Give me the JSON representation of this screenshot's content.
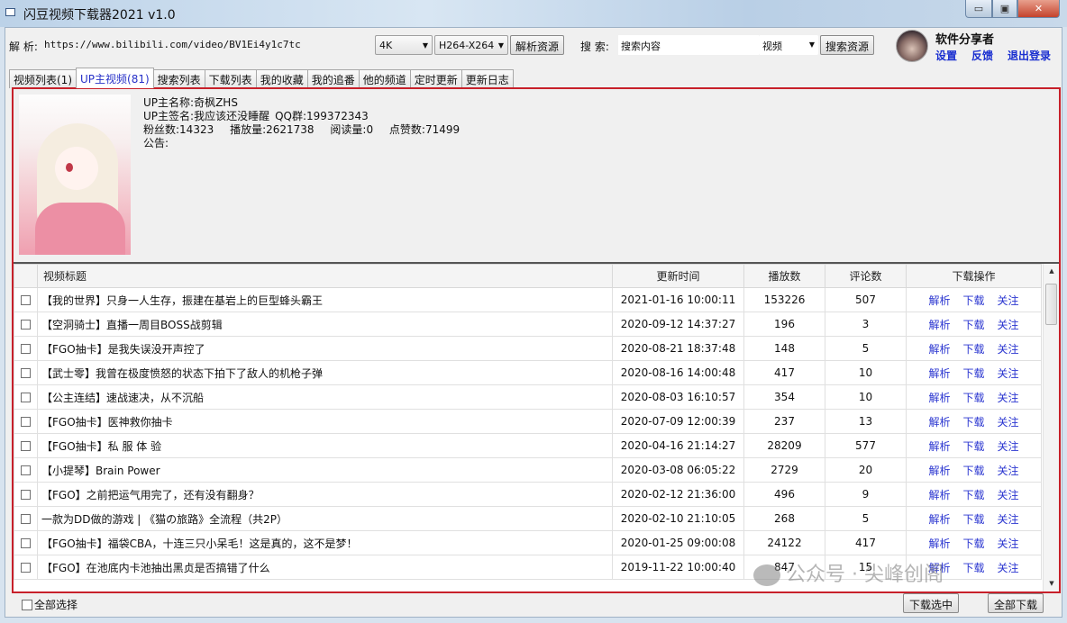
{
  "window": {
    "title": "闪豆视频下载器2021 v1.0",
    "controls": {
      "minimize": "▭",
      "maximize": "▣",
      "close": "✕"
    }
  },
  "toolbar": {
    "parse_label": "解 析:",
    "url_value": "https://www.bilibili.com/video/BV1Ei4y1c7tc",
    "quality_value": "4K",
    "codec_value": "H264-X264",
    "parse_button": "解析资源",
    "search_label": "搜 索:",
    "search_placeholder": "搜索内容",
    "search_type_value": "视频",
    "search_button": "搜索资源"
  },
  "user": {
    "name": "软件分享者",
    "links": [
      "设置",
      "反馈",
      "退出登录"
    ]
  },
  "tabs": [
    {
      "label": "视频列表(1)",
      "active": false
    },
    {
      "label": "UP主视频(81)",
      "active": true
    },
    {
      "label": "搜索列表",
      "active": false
    },
    {
      "label": "下载列表",
      "active": false
    },
    {
      "label": "我的收藏",
      "active": false
    },
    {
      "label": "我的追番",
      "active": false
    },
    {
      "label": "他的频道",
      "active": false
    },
    {
      "label": "定时更新",
      "active": false
    },
    {
      "label": "更新日志",
      "active": false
    }
  ],
  "uploader": {
    "name_label": "UP主名称:",
    "name": "奇枫ZHS",
    "sign_label": "UP主签名:",
    "sign": "我应该还没睡醒",
    "qq_label": "QQ群:",
    "qq": "199372343",
    "fans_label": "粉丝数:",
    "fans": "14323",
    "plays_label": "播放量:",
    "plays": "2621738",
    "reads_label": "阅读量:",
    "reads": "0",
    "likes_label": "点赞数:",
    "likes": "71499",
    "notice_label": "公告:",
    "notice": ""
  },
  "table": {
    "headers": [
      "视频标题",
      "更新时间",
      "播放数",
      "评论数",
      "下载操作"
    ],
    "actions": [
      "解析",
      "下载",
      "关注"
    ],
    "rows": [
      {
        "title": "【我的世界】只身一人生存，振建在基岩上的巨型蜂头霸王",
        "time": "2021-01-16 10:00:11",
        "plays": "153226",
        "comments": "507"
      },
      {
        "title": "【空洞骑士】直播一周目BOSS战剪辑",
        "time": "2020-09-12 14:37:27",
        "plays": "196",
        "comments": "3"
      },
      {
        "title": "【FGO抽卡】是我失误没开声控了",
        "time": "2020-08-21 18:37:48",
        "plays": "148",
        "comments": "5"
      },
      {
        "title": "【武士零】我曾在极度愤怒的状态下拍下了敌人的机枪子弹",
        "time": "2020-08-16 14:00:48",
        "plays": "417",
        "comments": "10"
      },
      {
        "title": "【公主连结】速战速决，从不沉船",
        "time": "2020-08-03 16:10:57",
        "plays": "354",
        "comments": "10"
      },
      {
        "title": "【FGO抽卡】医神救你抽卡",
        "time": "2020-07-09 12:00:39",
        "plays": "237",
        "comments": "13"
      },
      {
        "title": "【FGO抽卡】私 服 体 验",
        "time": "2020-04-16 21:14:27",
        "plays": "28209",
        "comments": "577"
      },
      {
        "title": "【小提琴】Brain Power",
        "time": "2020-03-08 06:05:22",
        "plays": "2729",
        "comments": "20"
      },
      {
        "title": "【FGO】之前把运气用完了，还有没有翻身？",
        "time": "2020-02-12 21:36:00",
        "plays": "496",
        "comments": "9"
      },
      {
        "title": "一款为DD做的游戏 | 《猫の旅路》全流程（共2P）",
        "time": "2020-02-10 21:10:05",
        "plays": "268",
        "comments": "5"
      },
      {
        "title": "【FGO抽卡】福袋CBA，十连三只小呆毛！这是真的，这不是梦！",
        "time": "2020-01-25 09:00:08",
        "plays": "24122",
        "comments": "417"
      },
      {
        "title": "【FGO】在池底内卡池抽出黑贞是否搞错了什么",
        "time": "2019-11-22 10:00:40",
        "plays": "847",
        "comments": "15"
      }
    ]
  },
  "bottom": {
    "select_all": "全部选择",
    "download_selected": "下载选中",
    "download_all": "全部下载"
  },
  "watermark": "公众号 · 尖峰创阁",
  "colors": {
    "accent_red": "#c7202a",
    "link_blue": "#2a35d0"
  }
}
